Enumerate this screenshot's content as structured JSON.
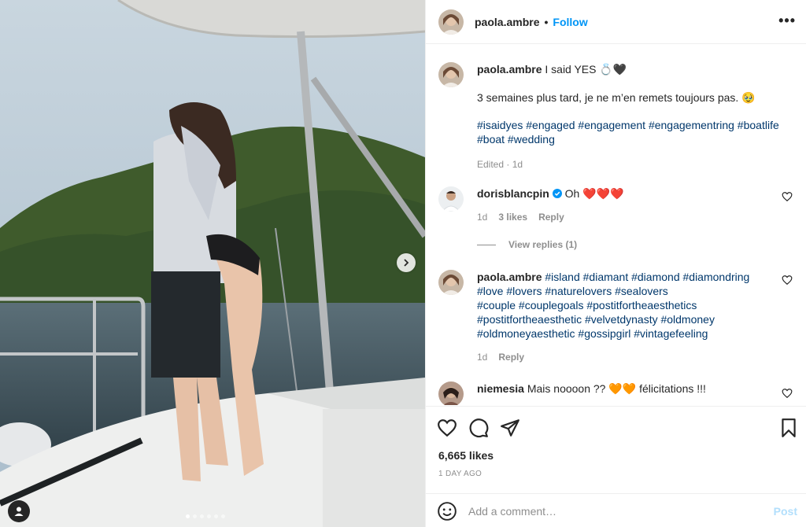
{
  "photo": {
    "alt_name": "couple embracing on catamaran deck",
    "carousel_total": 6,
    "carousel_active": 1
  },
  "header": {
    "username": "paola.ambre",
    "separator": "•",
    "follow_label": "Follow",
    "more_label": "•••"
  },
  "caption": {
    "username": "paola.ambre",
    "text": "I said YES 💍🖤",
    "line2": "3 semaines plus tard, je ne m’en remets toujours pas. 🥹",
    "hashtags_line1": "#isaidyes #engaged #engagement #engagementring #boatlife",
    "hashtags_line2": "#boat #wedding",
    "edited": "Edited · 1d"
  },
  "comments": [
    {
      "username": "dorisblancpin",
      "verified": true,
      "text": "Oh ❤️❤️❤️",
      "time": "1d",
      "likes": "3 likes",
      "reply": "Reply",
      "view_replies": "View replies (1)"
    },
    {
      "username": "paola.ambre",
      "lines": [
        "#island #diamant #diamond #diamondring",
        "#love #lovers #naturelovers #sealovers",
        "#couple #couplegoals #postitfortheaesthetics",
        "#postitfortheaesthetic #velvetdynasty #oldmoney",
        "#oldmoneyaesthetic #gossipgirl #vintagefeeling"
      ],
      "time": "1d",
      "reply": "Reply"
    },
    {
      "username": "niemesia",
      "text": "Mais noooon ?? 🧡🧡 félicitations !!!"
    }
  ],
  "actions": {
    "likes": "6,665 likes",
    "time": "1 DAY AGO"
  },
  "add_comment": {
    "placeholder": "Add a comment…",
    "post_label": "Post"
  },
  "colors": {
    "link": "#0095f6",
    "hashtag": "#00376b",
    "muted": "#8e8e8e",
    "post_disabled": "#b2dffc"
  }
}
